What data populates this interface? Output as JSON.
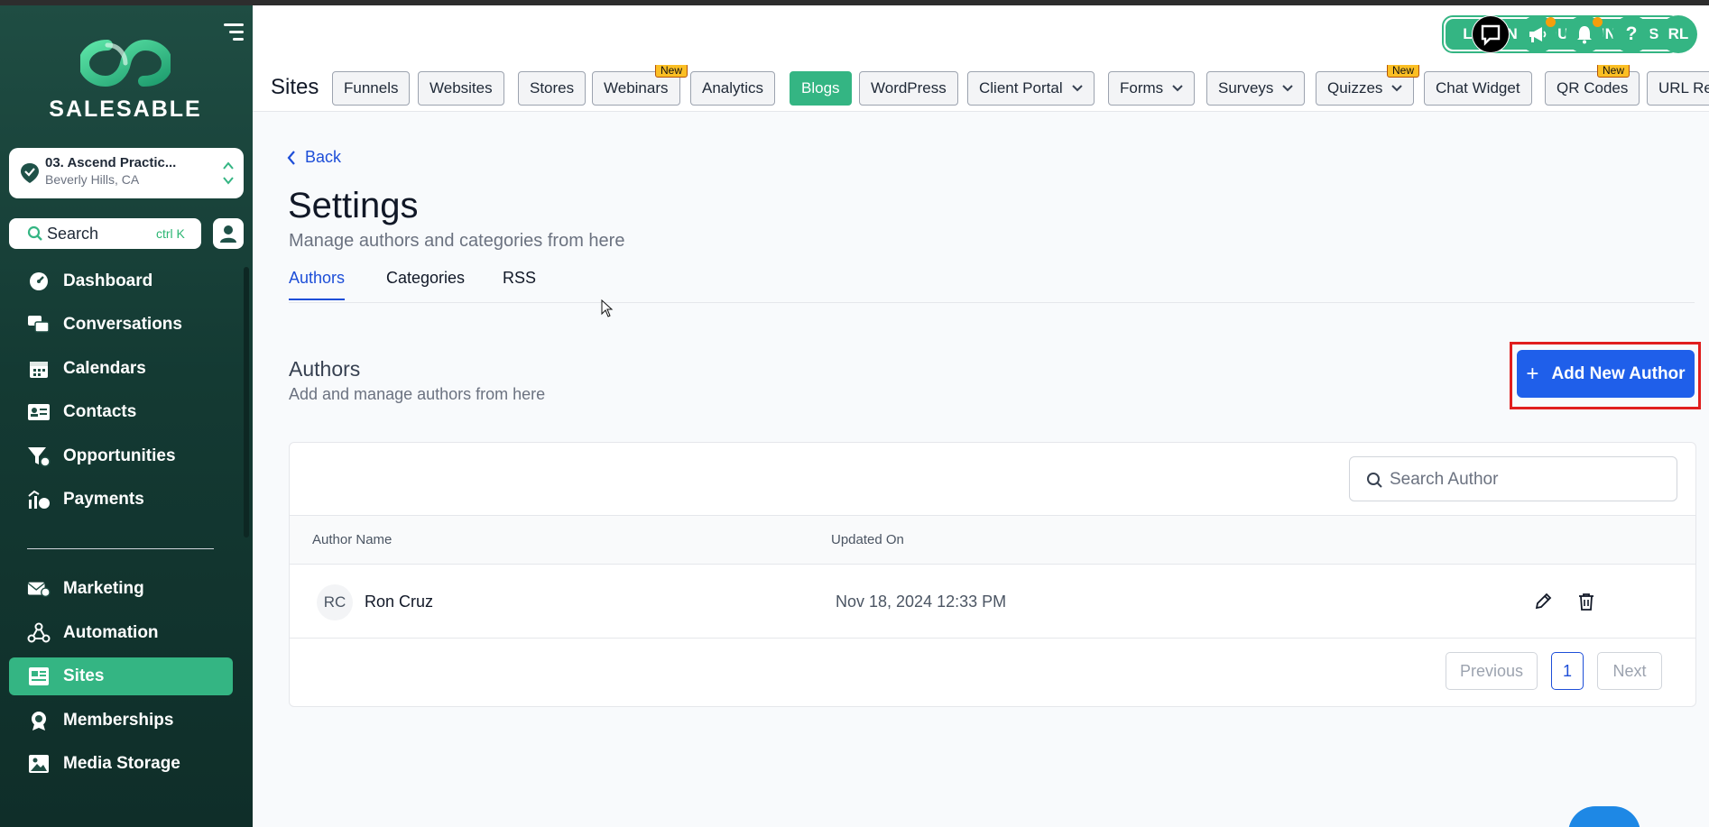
{
  "brand": {
    "name": "SALESABLE",
    "accent": "#34b583",
    "primary": "#1f5fea"
  },
  "location": {
    "name": "03. Ascend Practic...",
    "address": "Beverly Hills, CA"
  },
  "search": {
    "label": "Search",
    "shortcut": "ctrl K"
  },
  "sidebar": {
    "items": [
      {
        "label": "Dashboard",
        "icon": "dashboard-icon"
      },
      {
        "label": "Conversations",
        "icon": "chat-bubbles-icon"
      },
      {
        "label": "Calendars",
        "icon": "calendar-icon"
      },
      {
        "label": "Contacts",
        "icon": "id-card-icon"
      },
      {
        "label": "Opportunities",
        "icon": "funnel-icon"
      },
      {
        "label": "Payments",
        "icon": "payments-icon"
      },
      {
        "label": "Marketing",
        "icon": "envelope-icon"
      },
      {
        "label": "Automation",
        "icon": "workflow-icon"
      },
      {
        "label": "Sites",
        "icon": "sites-icon",
        "active": true
      },
      {
        "label": "Memberships",
        "icon": "badge-icon"
      },
      {
        "label": "Media Storage",
        "icon": "image-icon"
      }
    ]
  },
  "header": {
    "learn_label": "LEARN ABOUT FUNNELS",
    "avatar_initials": "RL"
  },
  "sites_nav": {
    "title": "Sites",
    "new_badge": "New",
    "tabs": [
      {
        "label": "Funnels"
      },
      {
        "label": "Websites"
      },
      {
        "label": "Stores"
      },
      {
        "label": "Webinars",
        "badge": "New"
      },
      {
        "label": "Analytics"
      },
      {
        "label": "Blogs",
        "active": true
      },
      {
        "label": "WordPress"
      },
      {
        "label": "Client Portal",
        "dropdown": true
      },
      {
        "label": "Forms",
        "dropdown": true
      },
      {
        "label": "Surveys",
        "dropdown": true
      },
      {
        "label": "Quizzes",
        "dropdown": true,
        "badge": "New"
      },
      {
        "label": "Chat Widget"
      },
      {
        "label": "QR Codes",
        "badge": "New"
      },
      {
        "label": "URL Red"
      }
    ]
  },
  "page": {
    "back_label": "Back",
    "title": "Settings",
    "subtitle": "Manage authors and categories from here",
    "subtabs": [
      "Authors",
      "Categories",
      "RSS"
    ]
  },
  "authors": {
    "title": "Authors",
    "subtitle": "Add and manage authors from here",
    "add_label": "Add New Author",
    "search_placeholder": "Search Author",
    "columns": [
      "Author Name",
      "Updated On"
    ],
    "rows": [
      {
        "initials": "RC",
        "name": "Ron Cruz",
        "updated": "Nov 18, 2024 12:33 PM"
      }
    ],
    "pagination": {
      "previous": "Previous",
      "current": "1",
      "next": "Next"
    }
  }
}
